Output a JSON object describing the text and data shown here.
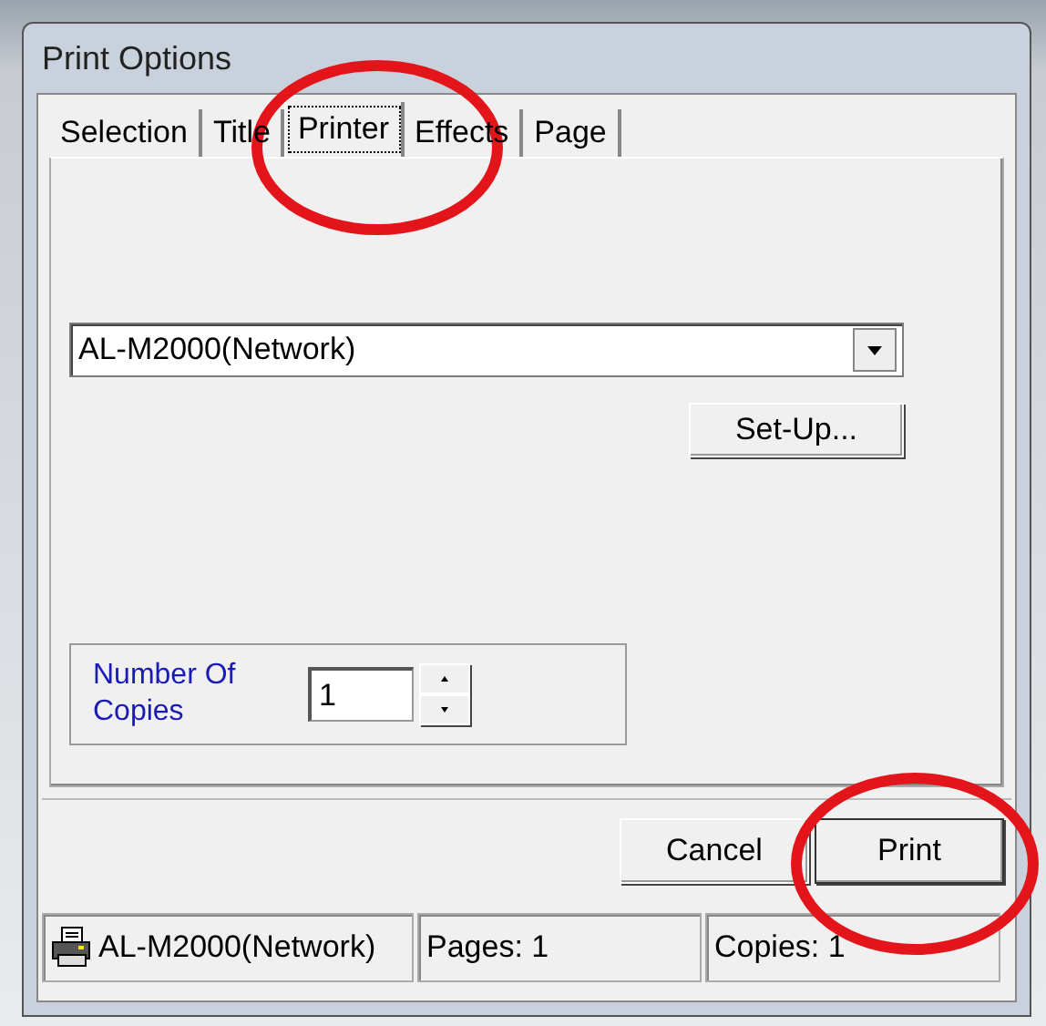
{
  "window": {
    "title": "Print Options"
  },
  "tabs": [
    {
      "label": "Selection",
      "selected": false
    },
    {
      "label": "Title",
      "selected": false
    },
    {
      "label": "Printer",
      "selected": true
    },
    {
      "label": "Effects",
      "selected": false
    },
    {
      "label": "Page",
      "selected": false
    }
  ],
  "printer": {
    "value": "AL-M2000(Network)",
    "setup_button": "Set-Up..."
  },
  "copies": {
    "label": "Number Of Copies",
    "value": "1"
  },
  "buttons": [
    {
      "label": "Cancel",
      "kind": "cancel"
    },
    {
      "label": "Print",
      "kind": "default"
    }
  ],
  "status_bar": {
    "printer": "AL-M2000(Network)",
    "pages": "Pages: 1",
    "copies": "Copies: 1"
  },
  "annotations": [
    {
      "kind": "circle"
    },
    {
      "kind": "circle"
    }
  ]
}
